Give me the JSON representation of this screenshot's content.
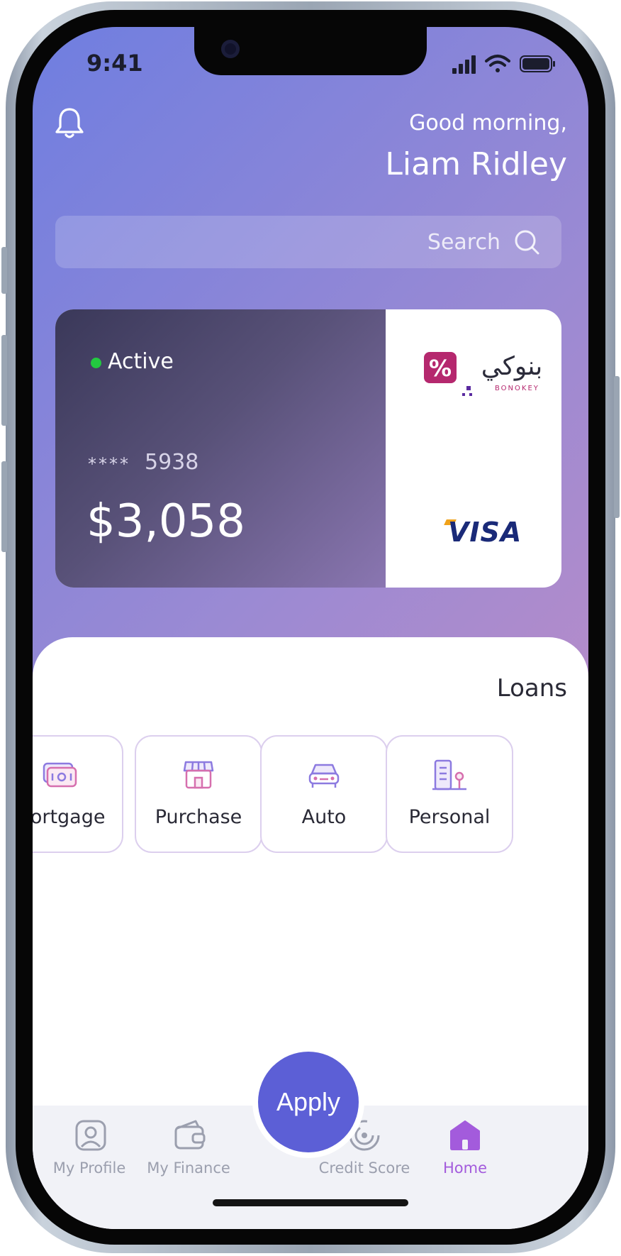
{
  "status_bar": {
    "time": "9:41"
  },
  "header": {
    "greeting": "Good morning,",
    "user_name": "Liam Ridley"
  },
  "search": {
    "placeholder": "Search"
  },
  "card": {
    "status": "Active",
    "masked": "****",
    "last4": "5938",
    "balance": "$3,058",
    "brand_arabic": "بنوكي",
    "brand_latin": "BONOKEY",
    "network": "VISA"
  },
  "loans": {
    "title": "Loans",
    "items": [
      {
        "label": "Mortgage",
        "icon": "money-icon"
      },
      {
        "label": "Purchase",
        "icon": "store-icon"
      },
      {
        "label": "Auto",
        "icon": "car-icon"
      },
      {
        "label": "Personal",
        "icon": "building-person-icon"
      }
    ]
  },
  "apply": {
    "label": "Apply"
  },
  "tabbar": {
    "items": [
      {
        "label": "My Profile",
        "icon": "profile-icon"
      },
      {
        "label": "My Finance",
        "icon": "wallet-icon"
      },
      {
        "label": "Credit Score",
        "icon": "credit-score-icon"
      },
      {
        "label": "Home",
        "icon": "home-icon",
        "active": true
      }
    ]
  },
  "colors": {
    "accent": "#a35bdc",
    "apply": "#5c5fd6",
    "active_dot": "#23c940"
  }
}
